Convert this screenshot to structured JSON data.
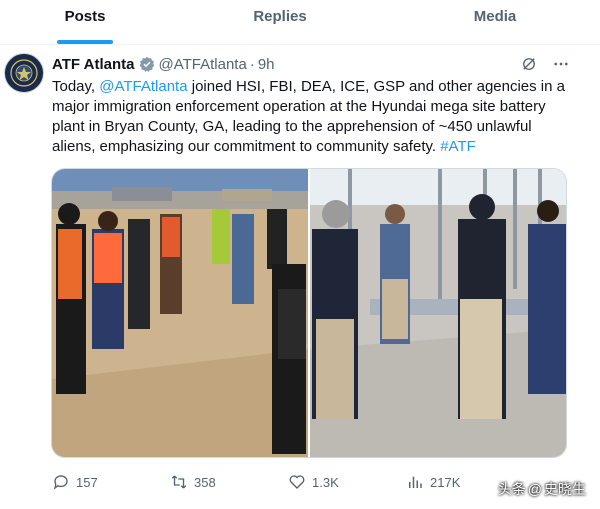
{
  "tabs": [
    {
      "label": "Posts",
      "active": true
    },
    {
      "label": "Replies",
      "active": false
    },
    {
      "label": "Media",
      "active": false
    }
  ],
  "tweet": {
    "display_name": "ATF Atlanta",
    "handle": "@ATFAtlanta",
    "separator": "·",
    "time": "9h",
    "text_before": "Today, ",
    "mention": "@ATFAtlanta",
    "text_after": " joined HSI, FBI, DEA, ICE, GSP and other agencies in a major immigration enforcement operation at the Hyundai mega site battery plant in Bryan County, GA, leading to the apprehension of ~450 unlawful aliens, emphasizing our commitment to community safety. ",
    "hashtag": "#ATF"
  },
  "actions": {
    "replies": "157",
    "retweets": "358",
    "likes": "1.3K",
    "views": "217K"
  },
  "watermark": {
    "prefix": "头条",
    "at": "@",
    "author": "史晓生"
  },
  "colors": {
    "accent": "#1d9bf0",
    "text": "#0f1419",
    "muted": "#536471",
    "border": "#cfd9de"
  },
  "icons": [
    "verified-badge-icon",
    "grok-icon",
    "more-icon",
    "reply-icon",
    "retweet-icon",
    "like-icon",
    "views-icon",
    "bookmark-icon",
    "share-icon"
  ]
}
